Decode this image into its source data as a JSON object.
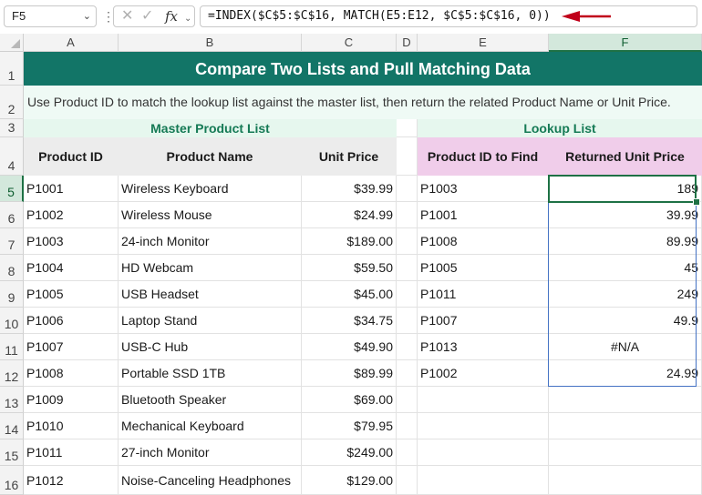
{
  "formula_bar": {
    "name_box": "F5",
    "formula": "=INDEX($C$5:$C$16, MATCH(E5:E12, $C$5:$C$16, 0))",
    "accent_arrow_color": "#c0001a"
  },
  "columns": [
    "A",
    "B",
    "C",
    "D",
    "E",
    "F"
  ],
  "rows": [
    "1",
    "2",
    "3",
    "4",
    "5",
    "6",
    "7",
    "8",
    "9",
    "10",
    "11",
    "12",
    "13",
    "14",
    "15",
    "16"
  ],
  "sheet": {
    "title": "Compare Two Lists and Pull Matching Data",
    "description": "Use Product ID to match the lookup list against the master list, then return the related Product Name or Unit Price.",
    "master_label": "Master Product List",
    "lookup_label": "Lookup List",
    "master_headers": [
      "Product ID",
      "Product Name",
      "Unit Price"
    ],
    "lookup_headers": [
      "Product ID to Find",
      "Returned Unit Price"
    ],
    "master_rows": [
      [
        "P1001",
        "Wireless Keyboard",
        "$39.99"
      ],
      [
        "P1002",
        "Wireless Mouse",
        "$24.99"
      ],
      [
        "P1003",
        "24-inch Monitor",
        "$189.00"
      ],
      [
        "P1004",
        "HD Webcam",
        "$59.50"
      ],
      [
        "P1005",
        "USB Headset",
        "$45.00"
      ],
      [
        "P1006",
        "Laptop Stand",
        "$34.75"
      ],
      [
        "P1007",
        "USB-C Hub",
        "$49.90"
      ],
      [
        "P1008",
        "Portable SSD 1TB",
        "$89.99"
      ],
      [
        "P1009",
        "Bluetooth Speaker",
        "$69.00"
      ],
      [
        "P1010",
        "Mechanical Keyboard",
        "$79.95"
      ],
      [
        "P1011",
        "27-inch Monitor",
        "$249.00"
      ],
      [
        "P1012",
        "Noise-Canceling Headphones",
        "$129.00"
      ]
    ],
    "lookup_rows": [
      [
        "P1003",
        "189"
      ],
      [
        "P1001",
        "39.99"
      ],
      [
        "P1008",
        "89.99"
      ],
      [
        "P1005",
        "45"
      ],
      [
        "P1011",
        "249"
      ],
      [
        "P1007",
        "49.9"
      ],
      [
        "P1013",
        "#N/A"
      ],
      [
        "P1002",
        "24.99"
      ]
    ]
  },
  "colors": {
    "title_bg": "#127567",
    "section_text": "#157a55",
    "lookup_header_bg": "#f0cdea",
    "selection": "#1e7145"
  }
}
